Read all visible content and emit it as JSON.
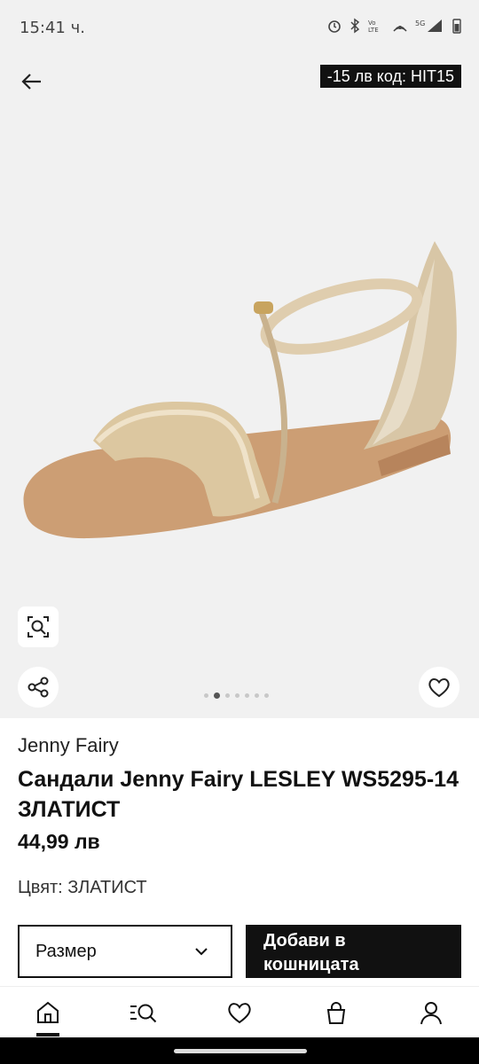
{
  "status_bar": {
    "time": "15:41 ч."
  },
  "promo": {
    "badge": "-15 лв код: HIT15"
  },
  "product": {
    "brand": "Jenny Fairy",
    "title": "Сандали Jenny Fairy LESLEY WS5295-14 ЗЛАТИСТ",
    "price": "44,99 лв",
    "color_line": "Цвят: ЗЛАТИСТ"
  },
  "gallery": {
    "image_count": 7,
    "active_index": 1
  },
  "actions": {
    "size_label": "Размер",
    "add_to_cart": "Добави в кошницата"
  },
  "icons": {
    "back": "arrow-left-icon",
    "zoom": "zoom-search-icon",
    "share": "share-icon",
    "wishlist": "heart-icon",
    "nav": [
      "home-icon",
      "search-menu-icon",
      "heart-icon",
      "bag-icon",
      "user-icon"
    ]
  }
}
